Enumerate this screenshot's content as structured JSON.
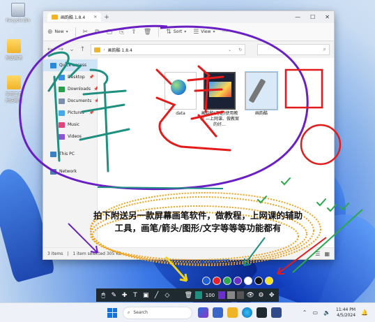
{
  "desktop": {
    "icons": [
      {
        "label": "Recycle Bin",
        "type": "bin"
      },
      {
        "label": "附送画笔",
        "type": "folder"
      },
      {
        "label": "实用工具\n附送画笔",
        "type": "folder"
      }
    ]
  },
  "explorer": {
    "tab_title": "画韵酷 1.8.4",
    "toolbar": {
      "new_label": "New",
      "sort_label": "Sort",
      "view_label": "View",
      "more_label": "···"
    },
    "address": {
      "path_root": "›",
      "path_label": "画韵酷 1.8.4"
    },
    "nav": [
      {
        "label": "Quick access",
        "icon_color": "#2b88d8",
        "indent": false,
        "pinned": false,
        "active": true
      },
      {
        "label": "Desktop",
        "icon_color": "#3b8fe0",
        "indent": true,
        "pinned": true,
        "active": false
      },
      {
        "label": "Downloads",
        "icon_color": "#2c9e4b",
        "indent": true,
        "pinned": true,
        "active": false
      },
      {
        "label": "Documents",
        "icon_color": "#7d8fa8",
        "indent": true,
        "pinned": true,
        "active": false
      },
      {
        "label": "Pictures",
        "icon_color": "#48a7e8",
        "indent": true,
        "pinned": true,
        "active": false
      },
      {
        "label": "Music",
        "icon_color": "#e0457b",
        "indent": true,
        "pinned": false,
        "active": false
      },
      {
        "label": "Videos",
        "icon_color": "#8a56d6",
        "indent": true,
        "pinned": false,
        "active": false
      },
      {
        "label": "This PC",
        "icon_color": "#3b82c4",
        "indent": false,
        "pinned": false,
        "active": false
      },
      {
        "label": "Network",
        "icon_color": "#4a7bb0",
        "indent": false,
        "pinned": false,
        "active": false
      }
    ],
    "files": [
      {
        "name": "data",
        "kind": "folder-data"
      },
      {
        "name": "画韵酷(无语)使用教程 —上网课、做教案的好…",
        "kind": "video"
      },
      {
        "name": "画韵酷",
        "kind": "tool"
      }
    ],
    "status": {
      "items": "3 items",
      "selected": "1 item selected 305 KB"
    }
  },
  "annotation": {
    "callout_text": "拍下附送另一款屏幕画笔软件，做教程，上网课的辅助工具，画笔/箭头/图形/文字等等等功能都有"
  },
  "pen_toolbar": {
    "size_value": "100",
    "colors": [
      "#1b5fd6",
      "#e8222a",
      "#2aa84a",
      "#6b2fc9",
      "#ffffff",
      "#111111",
      "#f6e21b"
    ]
  },
  "taskbar": {
    "search_placeholder": "Search",
    "time": "11:44 PM",
    "date": "4/5/2024"
  }
}
